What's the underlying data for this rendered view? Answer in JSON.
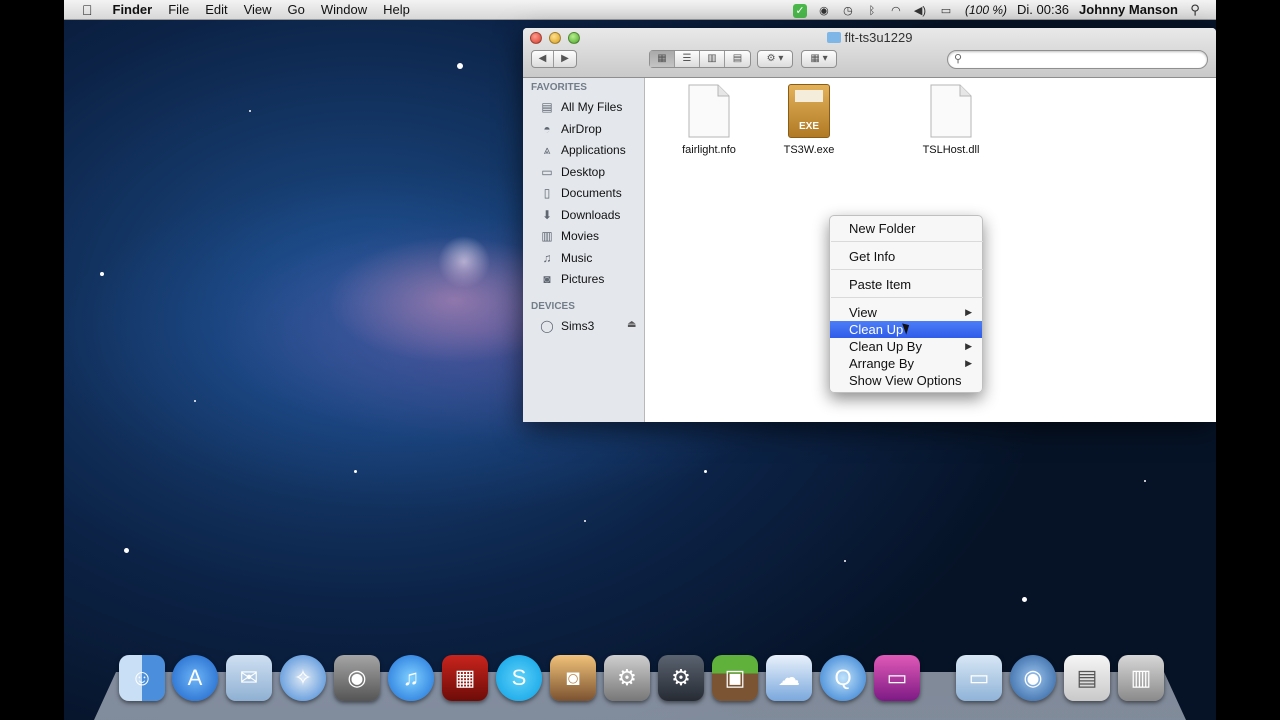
{
  "menubar": {
    "app_name": "Finder",
    "menus": [
      "File",
      "Edit",
      "View",
      "Go",
      "Window",
      "Help"
    ],
    "battery": "(100 %)",
    "clock": "Di. 00:36",
    "user": "Johnny Manson"
  },
  "window": {
    "title": "flt-ts3u1229",
    "search": {
      "value": "",
      "placeholder": ""
    }
  },
  "sidebar": {
    "favorites_header": "FAVORITES",
    "favorites": [
      {
        "label": "All My Files",
        "icon": "all-files-icon"
      },
      {
        "label": "AirDrop",
        "icon": "airdrop-icon"
      },
      {
        "label": "Applications",
        "icon": "applications-icon"
      },
      {
        "label": "Desktop",
        "icon": "desktop-icon"
      },
      {
        "label": "Documents",
        "icon": "documents-icon"
      },
      {
        "label": "Downloads",
        "icon": "downloads-icon"
      },
      {
        "label": "Movies",
        "icon": "movies-icon"
      },
      {
        "label": "Music",
        "icon": "music-icon"
      },
      {
        "label": "Pictures",
        "icon": "pictures-icon"
      }
    ],
    "devices_header": "DEVICES",
    "devices": [
      {
        "label": "Sims3",
        "icon": "disk-icon"
      }
    ]
  },
  "files": [
    {
      "name": "fairlight.nfo",
      "icon": "generic-document-icon"
    },
    {
      "name": "TS3W.exe",
      "icon": "exe-file-icon",
      "badge": "EXE"
    },
    {
      "name": "TSLHost.dll",
      "icon": "generic-document-icon"
    }
  ],
  "context_menu": {
    "groups": [
      [
        "New Folder"
      ],
      [
        "Get Info"
      ],
      [
        "Paste Item"
      ],
      [
        "View",
        "Clean Up",
        "Clean Up By",
        "Arrange By",
        "Show View Options"
      ]
    ],
    "highlighted": "Clean Up"
  },
  "colors": {
    "menu_highlight": "#3a67f0",
    "sidebar_bg": "#e4e8ed",
    "sidebar_header": "#737d88"
  }
}
